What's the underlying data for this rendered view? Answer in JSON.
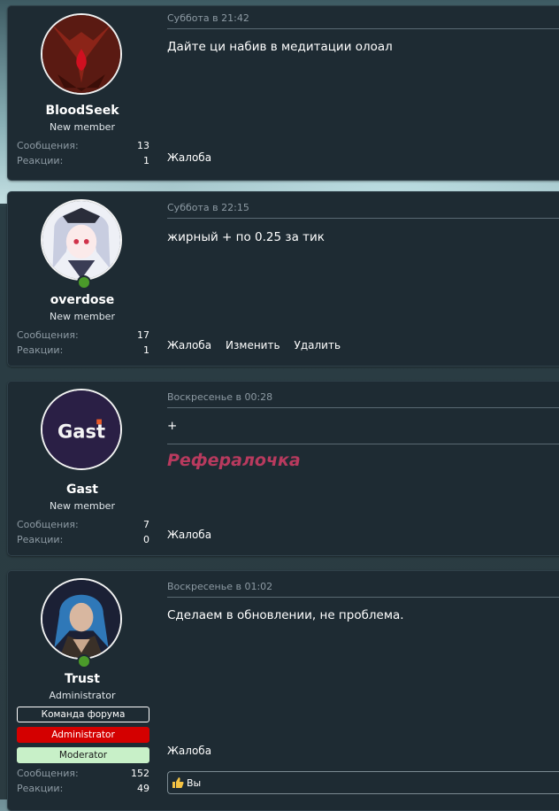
{
  "posts": [
    {
      "username": "BloodSeek",
      "usertitle": "New member",
      "messages_label": "Сообщения:",
      "messages": "13",
      "reactions_label": "Реакции:",
      "reactions": "1",
      "date": "Суббота в 21:42",
      "text": "Дайте ци набив в медитации олоал",
      "actions": [
        "Жалоба"
      ]
    },
    {
      "username": "overdose",
      "usertitle": "New member",
      "messages_label": "Сообщения:",
      "messages": "17",
      "reactions_label": "Реакции:",
      "reactions": "1",
      "date": "Суббота в 22:15",
      "text": "жирный + по 0.25 за тик",
      "actions": [
        "Жалоба",
        "Изменить",
        "Удалить"
      ]
    },
    {
      "username": "Gast",
      "usertitle": "New member",
      "messages_label": "Сообщения:",
      "messages": "7",
      "reactions_label": "Реакции:",
      "reactions": "0",
      "date": "Воскресенье в 00:28",
      "text": "+",
      "signature": "Рефералочка",
      "actions": [
        "Жалоба"
      ]
    },
    {
      "username": "Trust",
      "usertitle": "Administrator",
      "banners": [
        "Команда форума",
        "Administrator",
        "Moderator"
      ],
      "messages_label": "Сообщения:",
      "messages": "152",
      "reactions_label": "Реакции:",
      "reactions": "49",
      "date": "Воскресенье в 01:02",
      "text": "Сделаем в обновлении, не проблема.",
      "actions": [
        "Жалоба"
      ],
      "reaction_summary": "Вы"
    }
  ],
  "colors": {
    "panel": "#1e2b33",
    "signature": "#b83a5e",
    "banner_admin": "#d40000",
    "banner_moderator": "#c8f0c8",
    "online": "#4b9a2a"
  },
  "icons": {
    "like": "thumbs-up-icon"
  }
}
